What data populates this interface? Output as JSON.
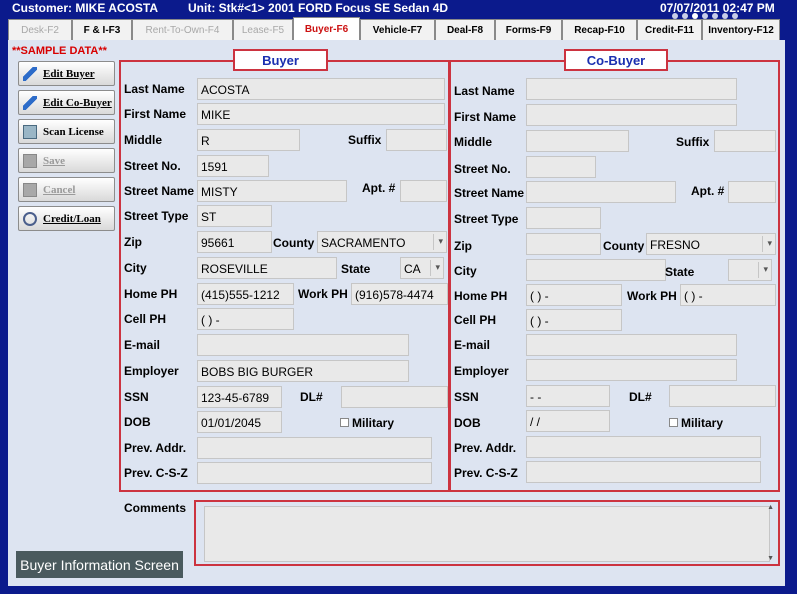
{
  "titlebar": {
    "customer": "Customer: MIKE ACOSTA",
    "unit": "Unit: Stk#<1>  2001 FORD Focus SE Sedan 4D",
    "datetime": "07/07/2011 02:47 PM"
  },
  "tabs": [
    {
      "label": "Desk-F2",
      "state": "disabled"
    },
    {
      "label": "F & I-F3",
      "state": "normal"
    },
    {
      "label": "Rent-To-Own-F4",
      "state": "disabled"
    },
    {
      "label": "Lease-F5",
      "state": "disabled"
    },
    {
      "label": "Buyer-F6",
      "state": "active"
    },
    {
      "label": "Vehicle-F7",
      "state": "normal"
    },
    {
      "label": "Deal-F8",
      "state": "normal"
    },
    {
      "label": "Forms-F9",
      "state": "normal"
    },
    {
      "label": "Recap-F10",
      "state": "normal"
    },
    {
      "label": "Credit-F11",
      "state": "normal"
    },
    {
      "label": "Inventory-F12",
      "state": "normal"
    }
  ],
  "sidebar": {
    "sample_label": "**SAMPLE DATA**",
    "buttons": [
      {
        "label": "Edit Buyer",
        "icon": "pencil-icon",
        "enabled": true
      },
      {
        "label": "Edit Co-Buyer",
        "icon": "pencil-icon",
        "enabled": true
      },
      {
        "label": "Scan License",
        "icon": "scanner-icon",
        "enabled": true
      },
      {
        "label": "Save",
        "icon": "save-icon",
        "enabled": false
      },
      {
        "label": "Cancel",
        "icon": "cancel-icon",
        "enabled": false
      },
      {
        "label": "Credit/Loan",
        "icon": "credit-icon",
        "enabled": true
      }
    ]
  },
  "labels": {
    "last_name": "Last Name",
    "first_name": "First Name",
    "middle": "Middle",
    "suffix": "Suffix",
    "street_no": "Street No.",
    "street_name": "Street Name",
    "apt": "Apt. #",
    "street_type": "Street Type",
    "zip": "Zip",
    "county": "County",
    "city": "City",
    "state": "State",
    "home_ph": "Home PH",
    "work_ph": "Work PH",
    "cell_ph": "Cell PH",
    "email": "E-mail",
    "employer": "Employer",
    "ssn": "SSN",
    "dl": "DL#",
    "dob": "DOB",
    "military": "Military",
    "prev_addr": "Prev. Addr.",
    "prev_csz": "Prev. C-S-Z",
    "comments": "Comments"
  },
  "buyer": {
    "title": "Buyer",
    "last_name": "ACOSTA",
    "first_name": "MIKE",
    "middle": "R",
    "suffix": "",
    "street_no": "1591",
    "street_name": "MISTY",
    "apt": "",
    "street_type": "ST",
    "zip": "95661",
    "county": "SACRAMENTO",
    "city": "ROSEVILLE",
    "state": "CA",
    "home_ph": "(415)555-1212",
    "work_ph": "(916)578-4474",
    "cell_ph": "(  )  -",
    "email": "",
    "employer": "BOBS BIG BURGER",
    "ssn": "123-45-6789",
    "dl": "",
    "dob": "01/01/2045",
    "military": false,
    "prev_addr": "",
    "prev_csz": ""
  },
  "cobuyer": {
    "title": "Co-Buyer",
    "last_name": "",
    "first_name": "",
    "middle": "",
    "suffix": "",
    "street_no": "",
    "street_name": "",
    "apt": "",
    "street_type": "",
    "zip": "",
    "county": "FRESNO",
    "city": "",
    "state": "",
    "home_ph": "(  )  -",
    "work_ph": "(  )  -",
    "cell_ph": "(  )  -",
    "email": "",
    "employer": "",
    "ssn": "  -  -",
    "dl": "",
    "dob": "  /  /",
    "military": false,
    "prev_addr": "",
    "prev_csz": ""
  },
  "comments": "",
  "status": "Buyer Information Screen"
}
